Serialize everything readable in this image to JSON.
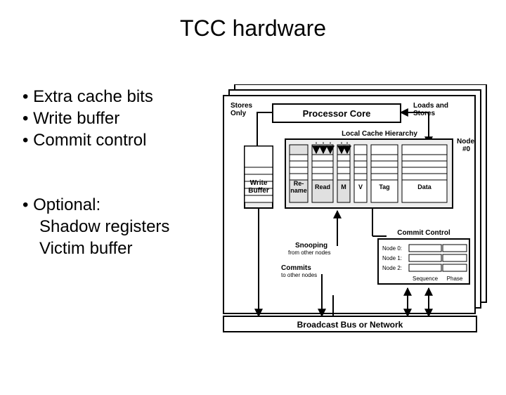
{
  "title": "TCC hardware",
  "bullets": {
    "b1": "Extra cache bits",
    "b2": "Write buffer",
    "b3": "Commit control",
    "b4": "Optional:",
    "b5": "Shadow registers",
    "b6": "Victim buffer"
  },
  "diagram": {
    "stores_only": "Stores\nOnly",
    "loads_stores": "Loads and\nStores",
    "proc_core": "Processor Core",
    "local_cache": "Local Cache Hierarchy",
    "node0": "Node\n#0",
    "write_buffer": "Write\nBuffer",
    "rename": "Re-\nname",
    "read": "Read",
    "m": "M",
    "v": "V",
    "tag": "Tag",
    "data": "Data",
    "snooping": "Snooping",
    "snooping_sub": "from other nodes",
    "commits": "Commits",
    "commits_sub": "to other nodes",
    "commit_control": "Commit Control",
    "cc_node0": "Node 0:",
    "cc_node1": "Node 1:",
    "cc_node2": "Node 2:",
    "sequence": "Sequence",
    "phase": "Phase",
    "bus": "Broadcast Bus or Network"
  }
}
